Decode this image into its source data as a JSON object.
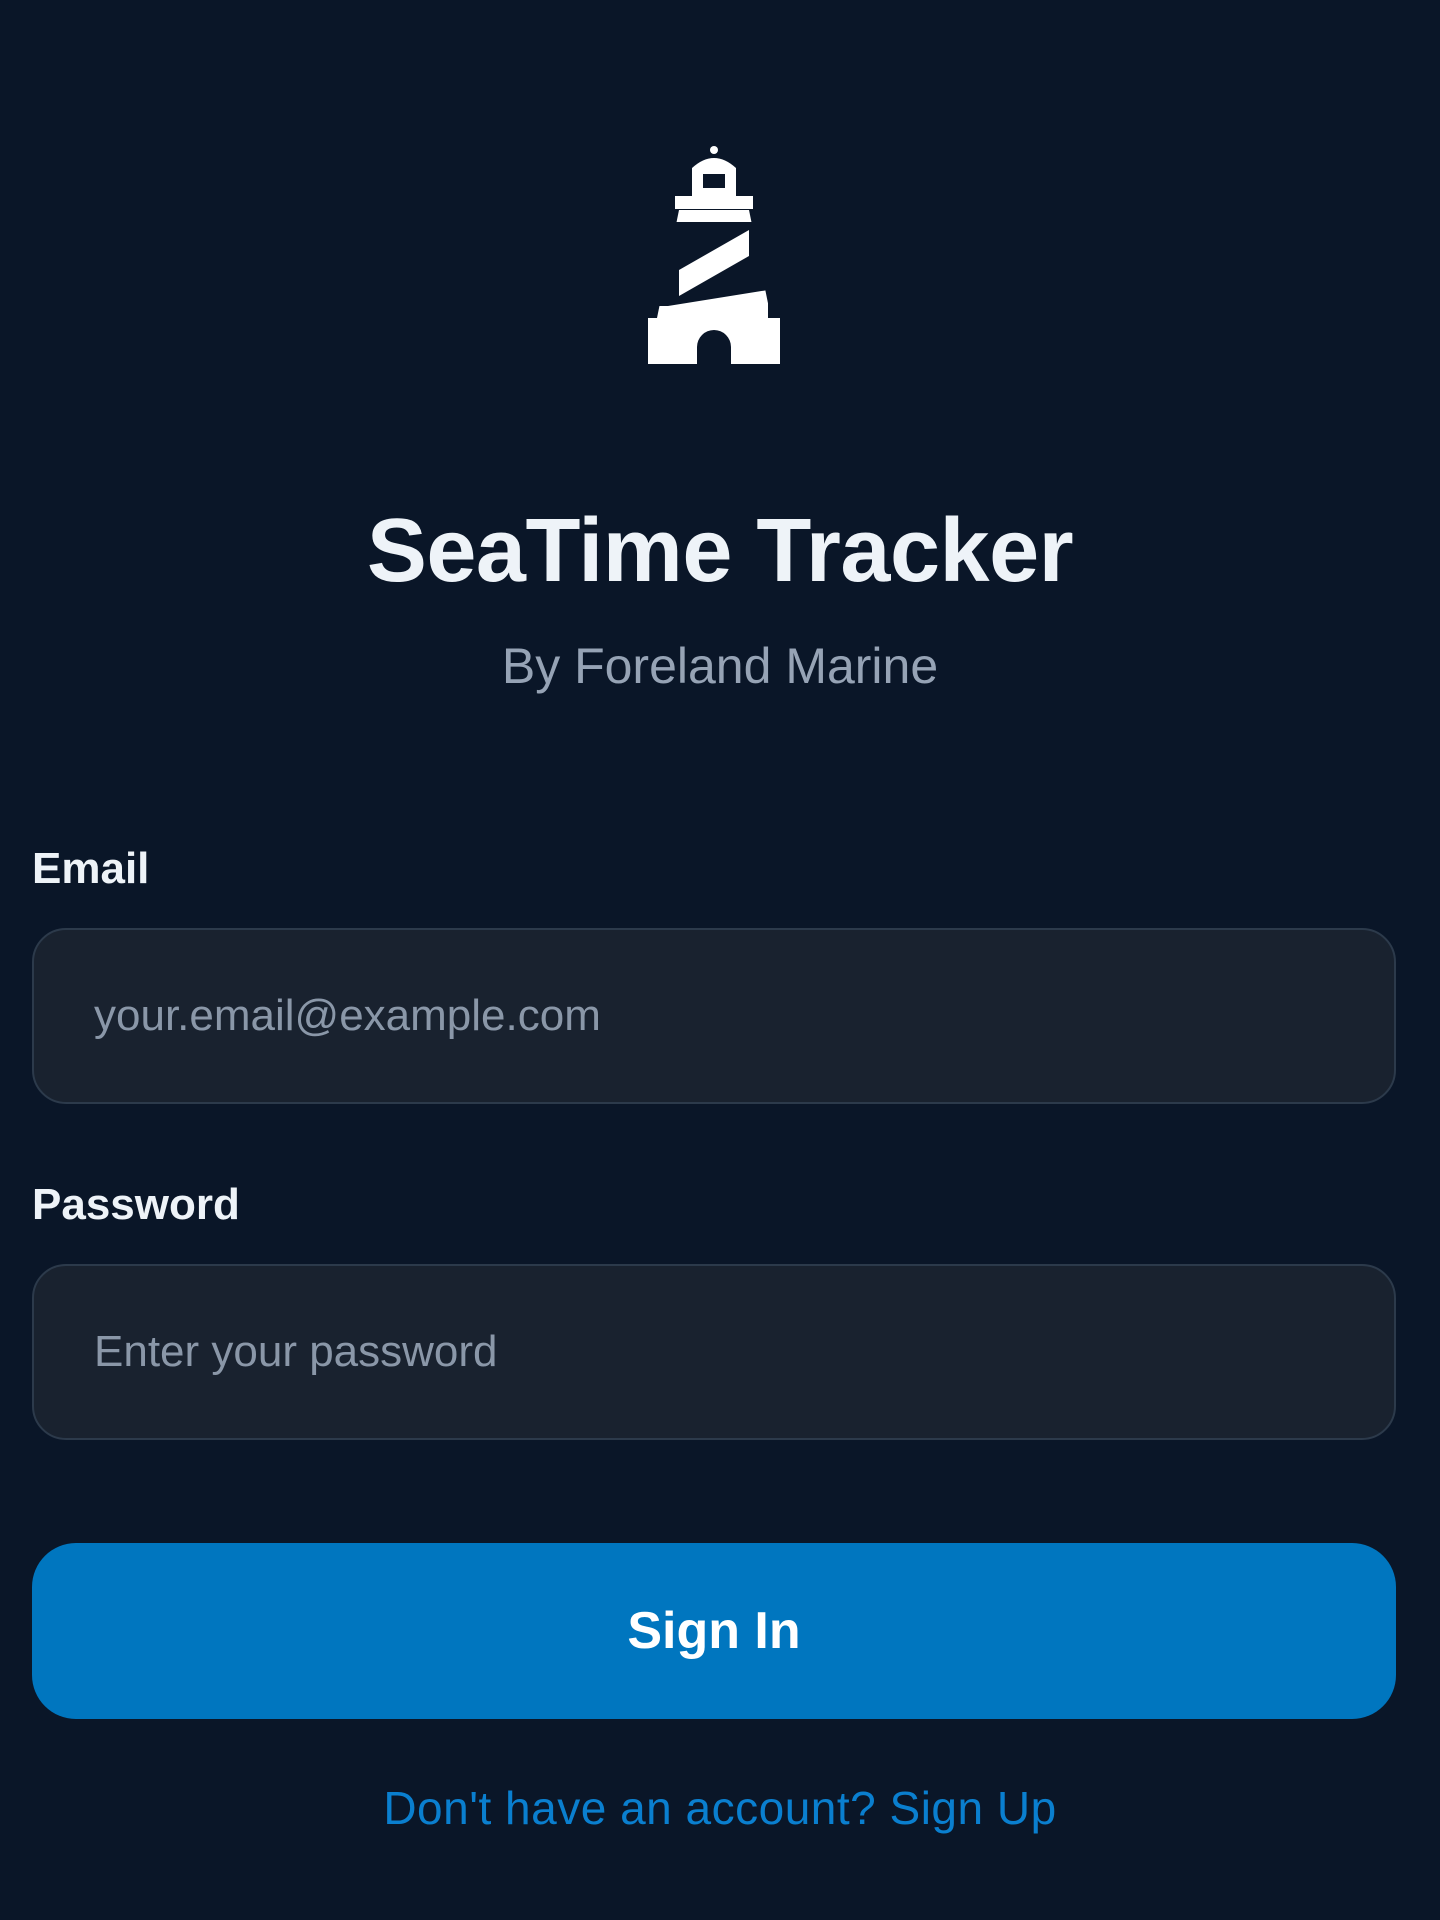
{
  "app": {
    "logo_icon": "lighthouse-icon",
    "title": "SeaTime Tracker",
    "subtitle": "By Foreland Marine"
  },
  "form": {
    "email_label": "Email",
    "email_value": "",
    "email_placeholder": "your.email@example.com",
    "password_label": "Password",
    "password_value": "",
    "password_placeholder": "Enter your password",
    "signin_label": "Sign In",
    "signup_text": "Don't have an account? Sign Up"
  },
  "colors": {
    "background": "#0a1628",
    "input_background": "#19222f",
    "input_border": "#2c3a4b",
    "primary": "#0076bf",
    "link": "#0a7fcf",
    "text": "#eef3f8",
    "muted_text": "#96a3b5"
  }
}
